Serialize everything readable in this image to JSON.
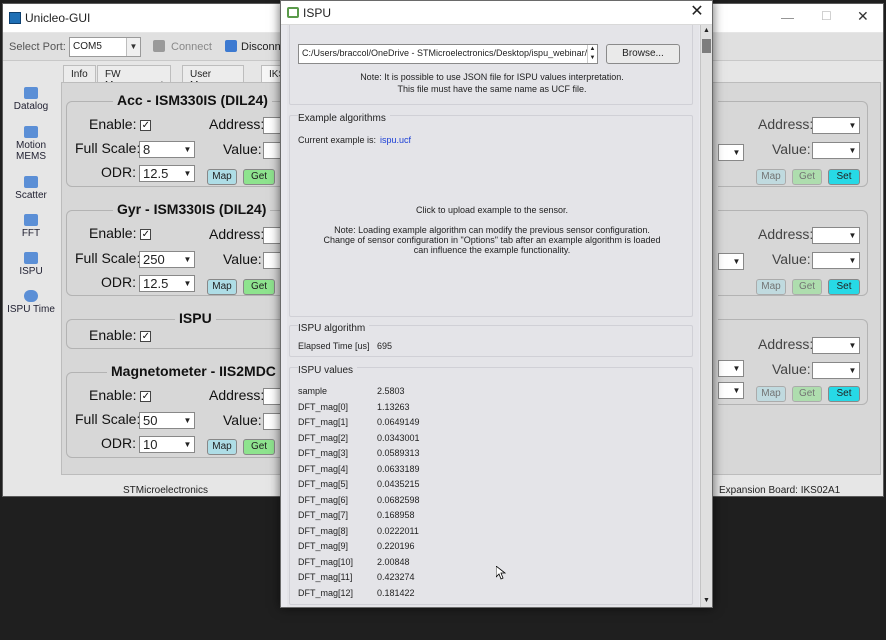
{
  "main_window": {
    "title": "Unicleo-GUI",
    "toolbar": {
      "select_port_label": "Select Port:",
      "port_value": "COM5",
      "connect_label": "Connect",
      "disconnect_label": "Disconnect"
    },
    "sidebar": [
      {
        "label": "Datalog",
        "icon": "floppy-icon"
      },
      {
        "label": "Motion MEMS",
        "icon": "motion-icon"
      },
      {
        "label": "Scatter",
        "icon": "scatter-icon"
      },
      {
        "label": "FFT",
        "icon": "fft-icon"
      },
      {
        "label": "ISPU",
        "icon": "ispu-icon"
      },
      {
        "label": "ISPU Time",
        "icon": "clock-icon"
      }
    ],
    "tabs": [
      "Info",
      "FW Management",
      "User Messages",
      "IKS"
    ],
    "groups": {
      "acc": {
        "title": "Acc - ISM330IS (DIL24)",
        "enable": "Enable:",
        "full_scale": "Full Scale:",
        "full_scale_value": "8",
        "odr": "ODR:",
        "odr_value": "12.5"
      },
      "gyr": {
        "title": "Gyr - ISM330IS (DIL24)",
        "enable": "Enable:",
        "full_scale": "Full Scale:",
        "full_scale_value": "250",
        "odr": "ODR:",
        "odr_value": "12.5"
      },
      "ispu": {
        "title": "ISPU",
        "enable": "Enable:"
      },
      "mag": {
        "title": "Magnetometer - IIS2MDC",
        "enable": "Enable:",
        "full_scale": "Full Scale:",
        "full_scale_value": "50",
        "odr": "ODR:",
        "odr_value": "10"
      }
    },
    "address_label": "Address:",
    "value_label": "Value:",
    "map_label": "Map",
    "get_label": "Get",
    "set_label": "Set",
    "status_left": "STMicroelectronics",
    "status_right": "Expansion Board: IKS02A1"
  },
  "ispu_dialog": {
    "title": "ISPU",
    "path_value": "C:/Users/braccol/OneDrive - STMicroelectronics/Desktop/ispu_webinar/",
    "browse_label": "Browse...",
    "note1": "Note: It is possible to use JSON file for ISPU values interpretation.",
    "note2": "This file must have the same name as UCF file.",
    "examples_title": "Example algorithms",
    "current_example_label": "Current example is:",
    "current_example_value": "ispu.ucf",
    "upload_hint": "Click to upload example to the sensor.",
    "load_note1": "Note: Loading example algorithm can modify the previous sensor configuration.",
    "load_note2": "Change of sensor configuration in \"Options\" tab after an example algorithm is loaded",
    "load_note3": "can influence the example functionality.",
    "algo_title": "ISPU algorithm",
    "elapsed_label": "Elapsed Time [us]",
    "elapsed_value": "695",
    "values_title": "ISPU values",
    "values": [
      {
        "k": "sample",
        "v": "2.5803"
      },
      {
        "k": "DFT_mag[0]",
        "v": "1.13263"
      },
      {
        "k": "DFT_mag[1]",
        "v": "0.0649149"
      },
      {
        "k": "DFT_mag[2]",
        "v": "0.0343001"
      },
      {
        "k": "DFT_mag[3]",
        "v": "0.0589313"
      },
      {
        "k": "DFT_mag[4]",
        "v": "0.0633189"
      },
      {
        "k": "DFT_mag[5]",
        "v": "0.0435215"
      },
      {
        "k": "DFT_mag[6]",
        "v": "0.0682598"
      },
      {
        "k": "DFT_mag[7]",
        "v": "0.168958"
      },
      {
        "k": "DFT_mag[8]",
        "v": "0.0222011"
      },
      {
        "k": "DFT_mag[9]",
        "v": "0.220196"
      },
      {
        "k": "DFT_mag[10]",
        "v": "2.00848"
      },
      {
        "k": "DFT_mag[11]",
        "v": "0.423274"
      },
      {
        "k": "DFT_mag[12]",
        "v": "0.181422"
      }
    ]
  }
}
